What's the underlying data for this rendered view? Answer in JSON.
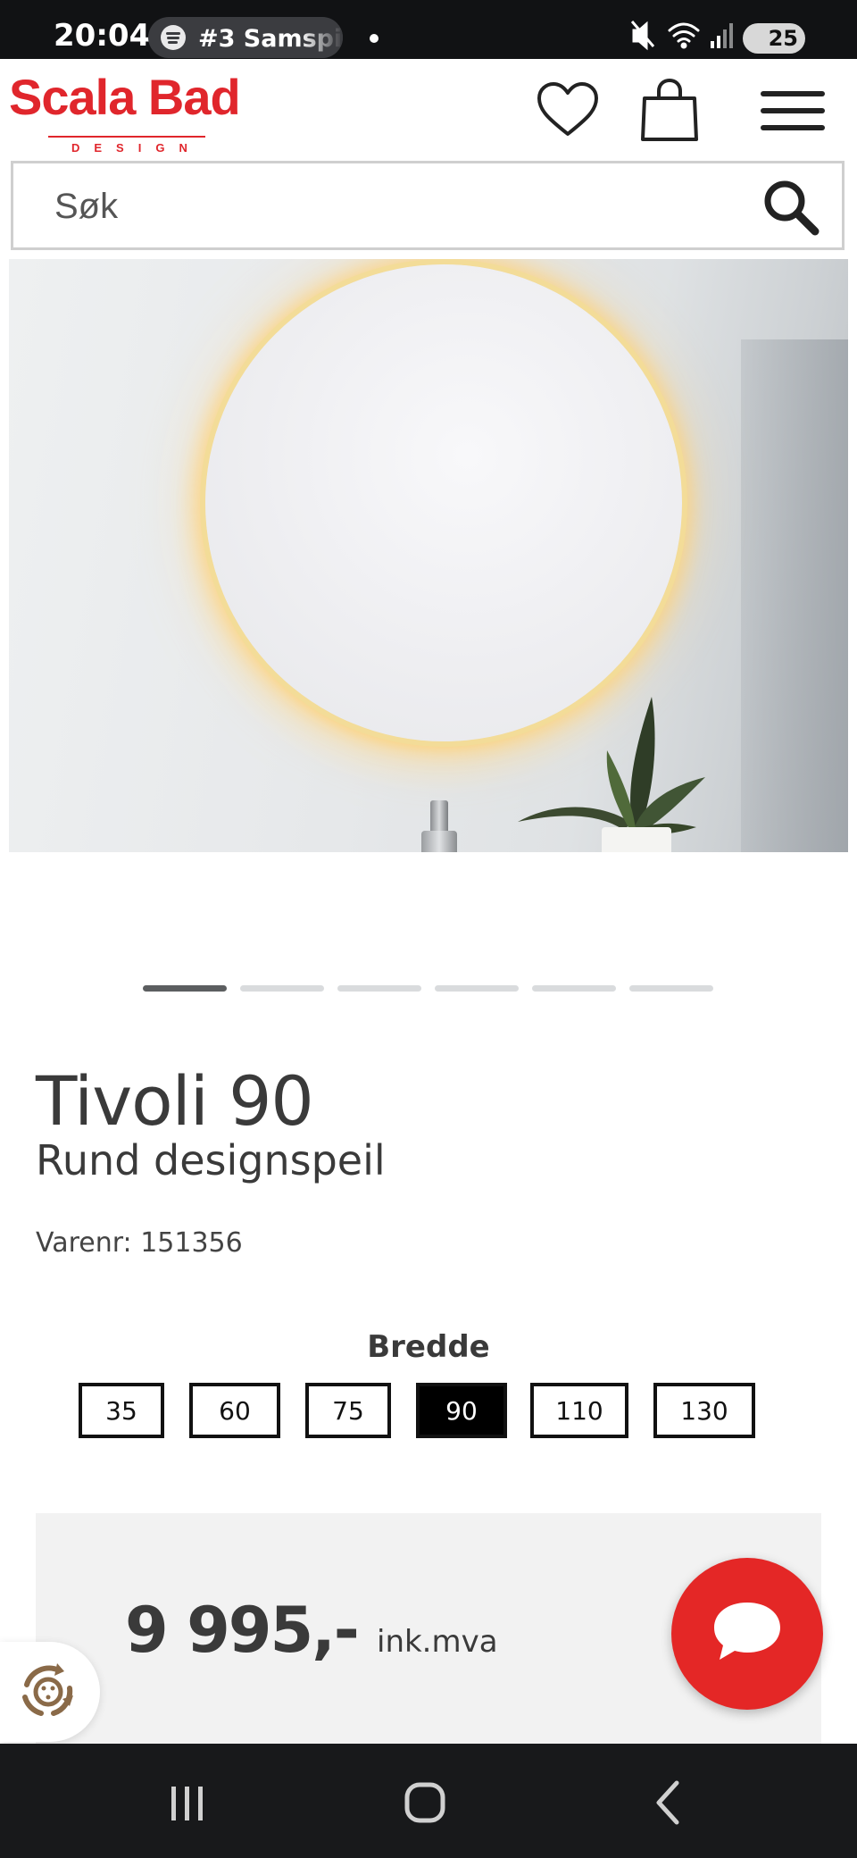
{
  "status_bar": {
    "time": "20:04",
    "media_title": "#3 Samspil",
    "battery": "25",
    "icons": [
      "spotify-icon",
      "mute-icon",
      "wifi-icon",
      "signal-icon",
      "battery-icon"
    ]
  },
  "header": {
    "logo_main": "Scala Bad",
    "logo_sub": "DESIGN",
    "icons": [
      "heart-icon",
      "shopping-bag-icon",
      "hamburger-menu-icon"
    ]
  },
  "search": {
    "placeholder": "Søk"
  },
  "gallery": {
    "slide_count": 6,
    "active_slide": 1
  },
  "product": {
    "title": "Tivoli 90",
    "subtitle": "Rund designspeil",
    "sku_label": "Varenr:",
    "sku_value": "151356"
  },
  "width_selector": {
    "label": "Bredde",
    "options": [
      "35",
      "60",
      "75",
      "90",
      "110",
      "130"
    ],
    "selected": "90"
  },
  "price": {
    "amount": "9 995,-",
    "vat_label": "ink.mva"
  },
  "colors": {
    "brand_red": "#e0262c",
    "chat_red": "#e42726",
    "text_dark": "#3a3a3a",
    "panel_bg": "#f2f2f2"
  },
  "nav_bar": {
    "icons": [
      "recent-apps-icon",
      "home-icon",
      "back-icon"
    ]
  }
}
